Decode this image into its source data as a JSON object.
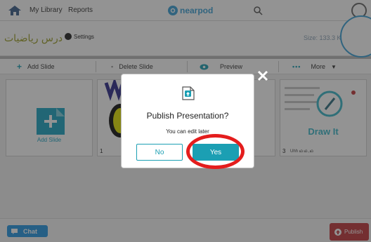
{
  "topbar": {
    "home_icon": "home-icon",
    "nav": [
      "My Library",
      "Reports"
    ],
    "logo_text": "nearpod",
    "search_icon": "search-icon"
  },
  "presentation": {
    "title": "درس رياضيات",
    "settings_label": "Settings",
    "size_text": "Size: 133.3 K"
  },
  "toolbar": {
    "add_slide": "Add Slide",
    "delete_slide": "Delete Slide",
    "preview": "Preview",
    "more": "More"
  },
  "slides": {
    "add_slide_label": "Add Slide",
    "items": [
      {
        "number": "1"
      },
      {
        "number": "3",
        "title": "Draw It",
        "caption": "Uhh ഥ ഥ ,ഥ"
      }
    ]
  },
  "bottombar": {
    "chat_label": "Chat",
    "publish_label": "Publish"
  },
  "modal": {
    "title": "Publish Presentation?",
    "subtitle": "You can edit later",
    "no_label": "No",
    "yes_label": "Yes"
  },
  "colors": {
    "teal": "#1b9fb3",
    "chat_blue": "#2497e3",
    "publish_red": "#c0373a",
    "highlight_red": "#e41d1d",
    "title_olive": "#9a9d22"
  }
}
